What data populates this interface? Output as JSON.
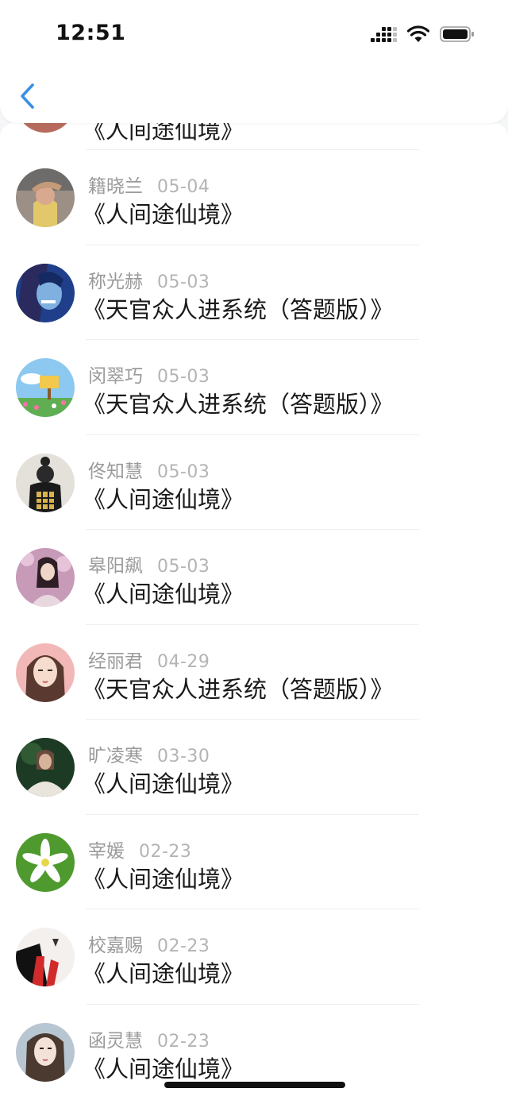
{
  "status_bar": {
    "time": "12:51"
  },
  "header": {
    "back_icon": "chevron-left-icon"
  },
  "partial_row": {
    "title": "《人间途仙境》"
  },
  "rows": [
    {
      "name": "籍晓兰",
      "date": "05-04",
      "title": "《人间途仙境》"
    },
    {
      "name": "称光赫",
      "date": "05-03",
      "title": "《天官众人进系统（答题版）》"
    },
    {
      "name": "闵翠巧",
      "date": "05-03",
      "title": "《天官众人进系统（答题版）》"
    },
    {
      "name": "佟知慧",
      "date": "05-03",
      "title": "《人间途仙境》"
    },
    {
      "name": "皋阳飙",
      "date": "05-03",
      "title": "《人间途仙境》"
    },
    {
      "name": "经丽君",
      "date": "04-29",
      "title": "《天官众人进系统（答题版）》"
    },
    {
      "name": "旷凌寒",
      "date": "03-30",
      "title": "《人间途仙境》"
    },
    {
      "name": "宰媛",
      "date": "02-23",
      "title": "《人间途仙境》"
    },
    {
      "name": "校嘉赐",
      "date": "02-23",
      "title": "《人间途仙境》"
    },
    {
      "name": "函灵慧",
      "date": "02-23",
      "title": "《人间途仙境》"
    }
  ],
  "colors": {
    "accent": "#3a8ee6",
    "name": "#9a9a9a",
    "date": "#b4b4b4",
    "title": "#1a1a1a"
  }
}
